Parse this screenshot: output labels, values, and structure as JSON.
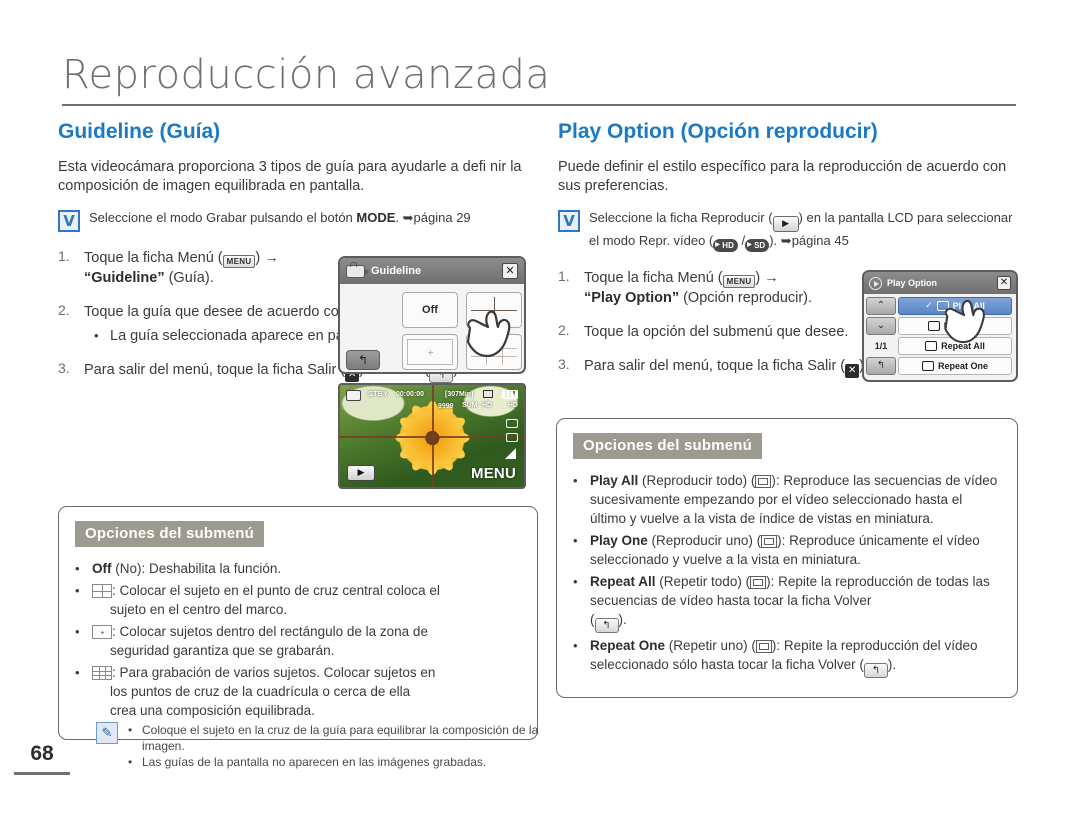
{
  "chapter": {
    "title": "Reproducción avanzada"
  },
  "folio": {
    "number": "68"
  },
  "left": {
    "heading": "Guideline (Guía)",
    "intro": "Esta videocámara proporciona 3 tipos de guía para ayudarle a defi nir la composición de imagen equilibrada en pantalla.",
    "vnote": {
      "before": "Seleccione el modo Grabar pulsando el botón ",
      "bold": "MODE",
      "after": ". ",
      "page_ref": "página 29"
    },
    "steps": [
      {
        "num": "1.",
        "before": "Toque la ficha Menú (",
        "chip": "MENU",
        "after": ") →",
        "line2_quote": "“Guideline”",
        "line2_rest": " (Guía)."
      },
      {
        "num": "2.",
        "text": "Toque la guía que desee de acuerdo con el sujeto.",
        "sub": "La guía seleccionada aparece en pantalla."
      },
      {
        "num": "3.",
        "text": "Para salir del menú, toque la ficha Salir (",
        "mid": ") o Volver (",
        "end": ")."
      }
    ],
    "lcd": {
      "title": "Guideline",
      "close_label": "✕",
      "off_label": "Off",
      "back_label": "↰",
      "icon_camera": "camcorder-icon"
    },
    "preview": {
      "stby": "STBY",
      "timecode": "00:00:00",
      "remaining": "[307Min]",
      "count": "9999",
      "quality1": "SUM",
      "quality2": "HD",
      "quality3": "HD",
      "play_label": "▶",
      "menu_label": "MENU"
    },
    "options": {
      "badge": "Opciones del submenú",
      "items": [
        {
          "bold": "Off",
          "text": " (No): Deshabilita la función."
        },
        {
          "icon": "grid-4-icon",
          "text": ": Colocar el sujeto en el punto de cruz central coloca el",
          "cont": "sujeto en el centro del marco."
        },
        {
          "icon": "safety-zone-icon",
          "text": ": Colocar sujetos dentro del rectángulo de la zona de",
          "cont": "seguridad garantiza que se grabarán."
        },
        {
          "icon": "grid-9-icon",
          "text": ": Para grabación de varios sujetos. Colocar sujetos en",
          "cont": "los puntos de cruz de la cuadrícula o cerca de ella",
          "cont2": "crea una composición equilibrada."
        }
      ]
    },
    "notes": [
      "Coloque el sujeto en la cruz de la guía para equilibrar la composición de la imagen.",
      "Las guías de la pantalla no aparecen en las imágenes grabadas."
    ]
  },
  "right": {
    "heading": "Play Option (Opción reproducir)",
    "intro": "Puede definir el estilo específico para la reproducción de acuerdo con sus preferencias.",
    "vnote": {
      "part1": "Seleccione la ficha Reproducir (",
      "part2": ") en la pantalla LCD para seleccionar",
      "part3": "el modo Repr. vídeo (",
      "hd": "HD",
      "sep": " /",
      "sd": "SD",
      "part4": "). ",
      "page_ref": "página 45"
    },
    "steps": [
      {
        "num": "1.",
        "before": "Toque la ficha Menú (",
        "chip": "MENU",
        "after": ") →",
        "line2_quote": "“Play Option”",
        "line2_rest": " (Opción reproducir)."
      },
      {
        "num": "2.",
        "text": "Toque la opción del submenú que desee."
      },
      {
        "num": "3.",
        "text": "Para salir del menú, toque la ficha Salir (",
        "mid": ") o Volver (",
        "end": ")."
      }
    ],
    "lcd": {
      "title": "Play Option",
      "close_label": "✕",
      "up_label": "⌃",
      "down_label": "⌄",
      "page_indicator": "1/1",
      "back_label": "↰",
      "rows": [
        {
          "label": "Play All",
          "selected": true,
          "check": "✓"
        },
        {
          "label": "Play One",
          "selected": false
        },
        {
          "label": "Repeat All",
          "selected": false
        },
        {
          "label": "Repeat One",
          "selected": false
        }
      ]
    },
    "options": {
      "badge": "Opciones del submenú",
      "items": [
        {
          "bold": "Play All",
          "paren": " (Reproducir todo) (",
          "icon": "play-all-icon",
          "text": "): Reproduce las secuencias",
          "lines": [
            "de vídeo sucesivamente empezando por el vídeo",
            "seleccionado hasta el último y vuelve a la vista de índice de",
            "vistas en miniatura."
          ]
        },
        {
          "bold": "Play One",
          "paren": " (Reproducir uno) (",
          "icon": "play-one-icon",
          "text": "): Reproduce únicamente el",
          "lines": [
            "vídeo seleccionado y vuelve a la vista en miniatura."
          ]
        },
        {
          "bold": "Repeat All",
          "paren": " (Repetir todo) (",
          "icon": "repeat-all-icon",
          "text": "): Repite la reproducción de",
          "lines": [
            "todas las secuencias de vídeo hasta tocar la ficha Volver",
            "( )."
          ]
        },
        {
          "bold": "Repeat One",
          "paren": " (Repetir uno) (",
          "icon": "repeat-one-icon",
          "text": "): Repite la reproducción del",
          "lines": [
            "vídeo seleccionado sólo hasta tocar la ficha Volver ( )."
          ]
        }
      ]
    }
  },
  "colors": {
    "heading_blue": "#1b7ac3",
    "badge_grey": "#9d9a8f",
    "selected_blue": "#5b85c4",
    "rule_grey": "#6f6f6f"
  }
}
